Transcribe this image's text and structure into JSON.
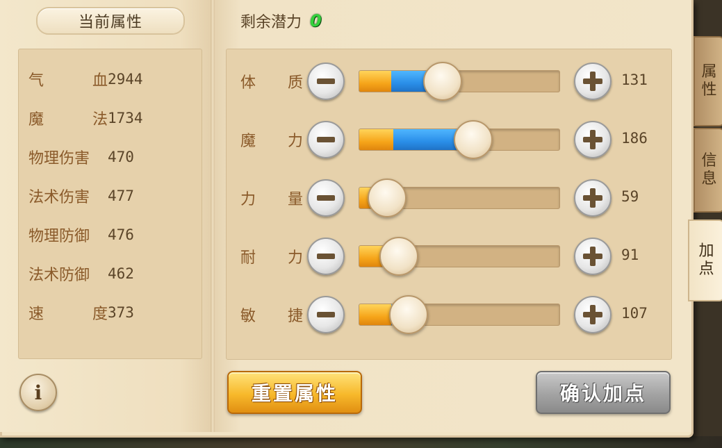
{
  "left_panel": {
    "title": "当前属性",
    "stats": [
      {
        "name_a": "气",
        "name_b": "血",
        "value": "2944"
      },
      {
        "name_a": "魔",
        "name_b": "法",
        "value": "1734"
      },
      {
        "name_a": "物理伤害",
        "name_b": "",
        "value": "470"
      },
      {
        "name_a": "法术伤害",
        "name_b": "",
        "value": "477"
      },
      {
        "name_a": "物理防御",
        "name_b": "",
        "value": "476"
      },
      {
        "name_a": "法术防御",
        "name_b": "",
        "value": "462"
      },
      {
        "name_a": "速",
        "name_b": "度",
        "value": "373"
      }
    ],
    "info_icon": "i"
  },
  "right_panel": {
    "potential_label": "剩余潜力",
    "potential_value": "0",
    "attributes": [
      {
        "name_a": "体",
        "name_b": "质",
        "value": "131",
        "base_fraction": 0.16,
        "total_fraction": 0.38
      },
      {
        "name_a": "魔",
        "name_b": "力",
        "value": "186",
        "base_fraction": 0.17,
        "total_fraction": 0.53
      },
      {
        "name_a": "力",
        "name_b": "量",
        "value": "59",
        "base_fraction": 0.1,
        "total_fraction": 0.1
      },
      {
        "name_a": "耐",
        "name_b": "力",
        "value": "91",
        "base_fraction": 0.16,
        "total_fraction": 0.16
      },
      {
        "name_a": "敏",
        "name_b": "捷",
        "value": "107",
        "base_fraction": 0.16,
        "total_fraction": 0.21
      }
    ],
    "reset_label": "重置属性",
    "confirm_label": "确认加点"
  },
  "side_tabs": [
    {
      "label_1": "属",
      "label_2": "性",
      "active": false
    },
    {
      "label_1": "信",
      "label_2": "息",
      "active": false
    },
    {
      "label_1": "加",
      "label_2": "点",
      "active": true
    }
  ],
  "colors": {
    "fill_base": "#f6a51a",
    "fill_added": "#2a8ee8",
    "potential": "#35d13c"
  },
  "icons": {
    "minus": "minus-icon",
    "plus": "plus-icon",
    "info": "info-icon"
  }
}
